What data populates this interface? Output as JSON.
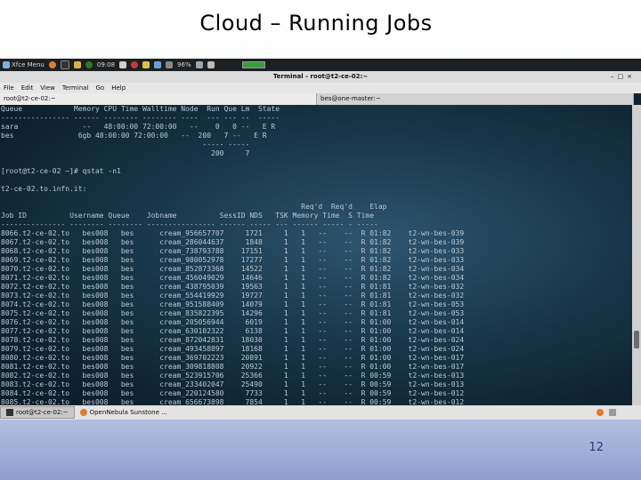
{
  "slide": {
    "title": "Cloud – Running Jobs",
    "page_number": "12"
  },
  "desktop": {
    "top_panel": {
      "menu_label": "Xfce Menu",
      "clock": "09:08",
      "battery": "96%"
    },
    "window": {
      "title": "Terminal - root@t2-ce-02:~",
      "menu": [
        "File",
        "Edit",
        "View",
        "Terminal",
        "Go",
        "Help"
      ],
      "tabs": [
        "root@t2-ce-02:~",
        "bes@one-master:~"
      ]
    },
    "terminal": {
      "queue_table": "Queue            Memory CPU Time Walltime Node  Run Que Lm  State\n---------------- ------ -------- -------- ----  --- --- --  -----\nsara               --   48:00:00 72:00:00   --    0   0 --   E R\nbes               6gb 48:00:00 72:00:00   --  200   7 --   E R\n                                               ----- -----\n                                                 200     7",
      "prompt": "[root@t2-ce-02 ~]# qstat -n1",
      "host": "t2-ce-02.to.infn.it:",
      "jobs_header": "                                                                      Req'd  Req'd    Elap\nJob ID          Username Queue    Jobname          SessID NDS   TSK Memory Time  S Time\n--------------- -------- -------- ---------------- ------ ----- --- ------ ----- - -----",
      "jobs": [
        "8066.t2-ce-02.to   bes008   bes      cream_956657707     1721     1   1   --    --  R 01:82    t2-wn-bes-039",
        "8067.t2-ce-02.to   bes008   bes      cream_286044637     1848     1   1   --    --  R 01:82    t2-wn-bes-039",
        "8068.t2-ce-02.to   bes008   bes      cream_738793788    17151     1   1   --    --  R 01:82    t2-wn-bes-033",
        "8069.t2-ce-02.to   bes008   bes      cream_980052978    17277     1   1   --    --  R 01:82    t2-wn-bes-033",
        "8070.t2-ce-02.to   bes008   bes      cream_852873368    14522     1   1   --    --  R 01:82    t2-wn-bes-034",
        "8071.t2-ce-02.to   bes008   bes      cream_456049029    14646     1   1   --    --  R 01:82    t2-wn-bes-034",
        "8072.t2-ce-02.to   bes008   bes      cream_438795039    19563     1   1   --    --  R 01:81    t2-wn-bes-032",
        "8073.t2-ce-02.to   bes008   bes      cream_554419929    19727     1   1   --    --  R 01:81    t2-wn-bes-032",
        "8074.t2-ce-02.to   bes008   bes      cream_951588409    14079     1   1   --    --  R 01:81    t2-wn-bes-053",
        "8075.t2-ce-02.to   bes008   bes      cream_835822395    14296     1   1   --    --  R 01:81    t2-wn-bes-053",
        "8076.t2-ce-02.to   bes008   bes      cream_205056944     6019     1   1   --    --  R 01:00    t2-wn-bes-014",
        "8077.t2-ce-02.to   bes008   bes      cream_630102322     6138     1   1   --    --  R 01:00    t2-wn-bes-014",
        "8078.t2-ce-02.to   bes008   bes      cream_872042831    18030     1   1   --    --  R 01:00    t2-wn-bes-024",
        "8079.t2-ce-02.to   bes008   bes      cream_493458897    18168     1   1   --    --  R 01:00    t2-wn-bes-024",
        "8080.t2-ce-02.to   bes008   bes      cream_369702223    20891     1   1   --    --  R 01:00    t2-wn-bes-017",
        "8081.t2-ce-02.to   bes008   bes      cream_309818808    20922     1   1   --    --  R 01:00    t2-wn-bes-017",
        "8082.t2-ce-02.to   bes008   bes      cream_523915706    25366     1   1   --    --  R 00:59    t2-wn-bes-013",
        "8083.t2-ce-02.to   bes008   bes      cream_233402047    25490     1   1   --    --  R 00:59    t2-wn-bes-013",
        "8084.t2-ce-02.to   bes008   bes      cream_220124580     7733     1   1   --    --  R 00:59    t2-wn-bes-012",
        "8085.t2-ce-02.to   bes008   bes      cream_656673898     7854     1   1   --    --  R 00:59    t2-wn-bes-012"
      ]
    },
    "taskbar": {
      "tasks": [
        "root@t2-ce-02:~",
        "OpenNebula Sunstone ..."
      ]
    }
  },
  "colors": {
    "terminal_bg": "#1a3a4e",
    "terminal_text": "#b9c9d4",
    "slide_gradient_bottom": "#8e9fd0"
  }
}
